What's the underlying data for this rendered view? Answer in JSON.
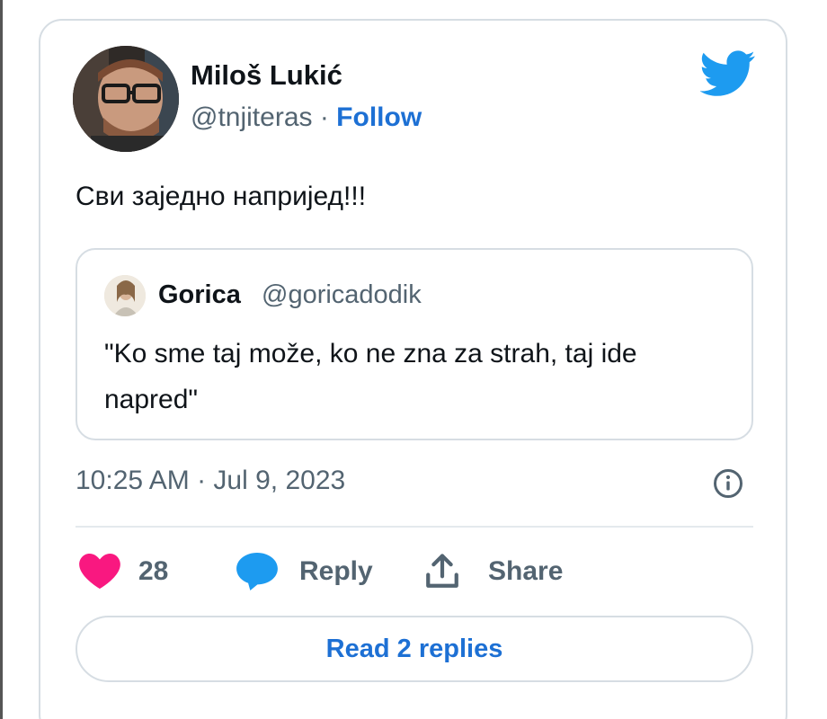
{
  "author": {
    "name": "Miloš Lukić",
    "handle": "@tnjiteras",
    "separator": " · ",
    "follow_label": "Follow"
  },
  "tweet": {
    "text": "Сви заједно напријед!!!"
  },
  "quoted_tweet": {
    "name": "Gorica",
    "handle": "@goricadodik",
    "text": "\"Ko sme taj može, ko ne zna za strah, taj ide napred\""
  },
  "meta": {
    "timestamp": "10:25 AM · Jul 9, 2023"
  },
  "actions": {
    "like_count": "28",
    "reply_label": "Reply",
    "share_label": "Share"
  },
  "footer": {
    "read_replies_label": "Read 2 replies"
  },
  "icons": {
    "brand": "twitter-bird-icon",
    "like": "heart-icon",
    "reply": "speech-bubble-icon",
    "share": "share-upload-icon",
    "info": "info-icon"
  },
  "colors": {
    "link_blue": "#1d70d4",
    "twitter_blue": "#1d9bf0",
    "like_pink": "#f91880",
    "text_primary": "#0f1419",
    "text_secondary": "#536471",
    "border": "#d6dde3"
  }
}
